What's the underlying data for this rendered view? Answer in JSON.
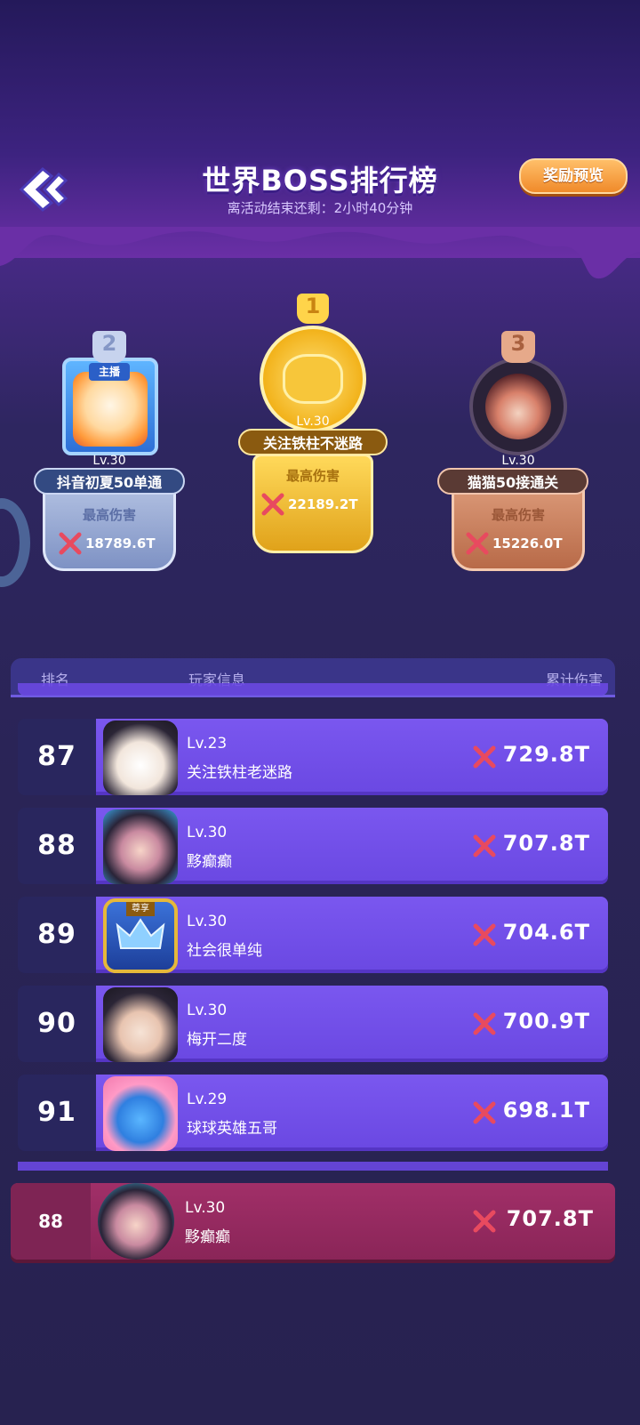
{
  "header": {
    "title": "世界BOSS排行榜",
    "countdown": "离活动结束还剩：2小时40分钟",
    "reward_button": "奖励预览"
  },
  "podium": {
    "first": {
      "rank": "1",
      "level": "Lv.30",
      "name": "关注铁柱不迷路",
      "damage_label": "最高伤害",
      "damage": "22189.2T"
    },
    "second": {
      "rank": "2",
      "tag": "主播",
      "level": "Lv.30",
      "name": "抖音初夏50单通",
      "damage_label": "最高伤害",
      "damage": "18789.6T"
    },
    "third": {
      "rank": "3",
      "level": "Lv.30",
      "name": "猫猫50接通关",
      "damage_label": "最高伤害",
      "damage": "15226.0T"
    }
  },
  "board": {
    "col_rank": "排名",
    "col_player": "玩家信息",
    "col_damage": "累计伤害",
    "rows": [
      {
        "rank": "87",
        "level": "Lv.23",
        "name": "关注铁柱老迷路",
        "damage": "729.8T",
        "avatar": "black-cat-hood-avatar"
      },
      {
        "rank": "88",
        "level": "Lv.30",
        "name": "黟癫癫",
        "damage": "707.8T",
        "avatar": "dragon-girl-avatar"
      },
      {
        "rank": "89",
        "level": "Lv.30",
        "name": "社会很单纯",
        "damage": "704.6T",
        "avatar": "crown-frame-avatar",
        "frame_tag": "尊享"
      },
      {
        "rank": "90",
        "level": "Lv.30",
        "name": "梅开二度",
        "damage": "700.9T",
        "avatar": "black-cat-hood-avatar"
      },
      {
        "rank": "91",
        "level": "Lv.29",
        "name": "球球英雄五哥",
        "damage": "698.1T",
        "avatar": "pink-bear-avatar"
      }
    ]
  },
  "mine": {
    "rank": "88",
    "level": "Lv.30",
    "name": "黟癫癫",
    "damage": "707.8T"
  },
  "colors": {
    "row_purple": "#6a48e2",
    "mine_magenta": "#8a2558",
    "gold": "#f2c53a",
    "silver": "#9fb3dc",
    "bronze": "#c87a5a"
  }
}
